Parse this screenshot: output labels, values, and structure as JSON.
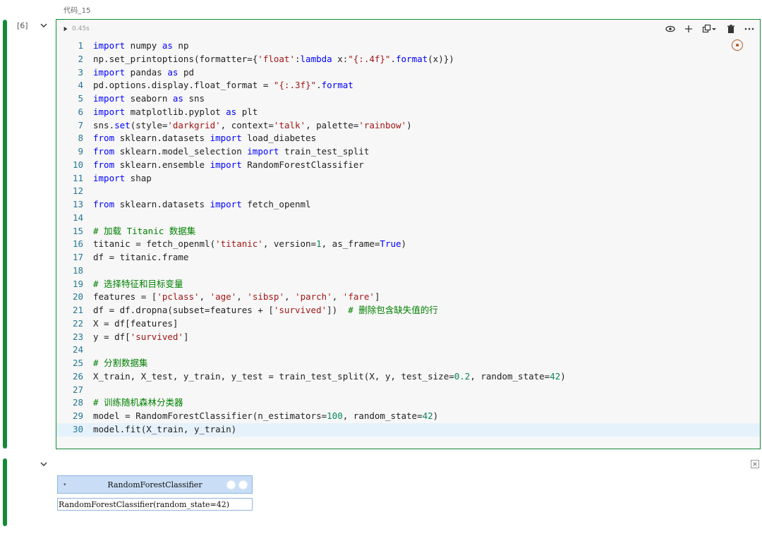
{
  "cell": {
    "title": "代码_15",
    "exec_count": "[6]",
    "exec_time": "0.45s"
  },
  "icons": {
    "run": "play-icon",
    "collapse": "chevron-down-icon",
    "toolbar": [
      "eye-icon",
      "plus-icon",
      "copy-icon",
      "chevron-down-icon",
      "trash-icon",
      "more-icon"
    ],
    "status": "execution-status-icon",
    "output_close": "close-icon"
  },
  "code": {
    "lines": [
      [
        {
          "t": "import",
          "k": "kw"
        },
        {
          "t": " numpy ",
          "k": "def"
        },
        {
          "t": "as",
          "k": "kw"
        },
        {
          "t": " np",
          "k": "def"
        }
      ],
      [
        {
          "t": "np.set_printoptions(formatter={",
          "k": "def"
        },
        {
          "t": "'float'",
          "k": "str"
        },
        {
          "t": ":",
          "k": "def"
        },
        {
          "t": "lambda",
          "k": "kw"
        },
        {
          "t": " x:",
          "k": "def"
        },
        {
          "t": "\"{:.4f}\"",
          "k": "str"
        },
        {
          "t": ".",
          "k": "def"
        },
        {
          "t": "format",
          "k": "kw"
        },
        {
          "t": "(x)})",
          "k": "def"
        }
      ],
      [
        {
          "t": "import",
          "k": "kw"
        },
        {
          "t": " pandas ",
          "k": "def"
        },
        {
          "t": "as",
          "k": "kw"
        },
        {
          "t": " pd",
          "k": "def"
        }
      ],
      [
        {
          "t": "pd.options.display.float_format = ",
          "k": "def"
        },
        {
          "t": "\"{:.3f}\"",
          "k": "str"
        },
        {
          "t": ".",
          "k": "def"
        },
        {
          "t": "format",
          "k": "kw"
        }
      ],
      [
        {
          "t": "import",
          "k": "kw"
        },
        {
          "t": " seaborn ",
          "k": "def"
        },
        {
          "t": "as",
          "k": "kw"
        },
        {
          "t": " sns",
          "k": "def"
        }
      ],
      [
        {
          "t": "import",
          "k": "kw"
        },
        {
          "t": " matplotlib.pyplot ",
          "k": "def"
        },
        {
          "t": "as",
          "k": "kw"
        },
        {
          "t": " plt",
          "k": "def"
        }
      ],
      [
        {
          "t": "sns.",
          "k": "def"
        },
        {
          "t": "set",
          "k": "kw"
        },
        {
          "t": "(style=",
          "k": "def"
        },
        {
          "t": "'darkgrid'",
          "k": "str"
        },
        {
          "t": ", context=",
          "k": "def"
        },
        {
          "t": "'talk'",
          "k": "str"
        },
        {
          "t": ", palette=",
          "k": "def"
        },
        {
          "t": "'rainbow'",
          "k": "str"
        },
        {
          "t": ")",
          "k": "def"
        }
      ],
      [
        {
          "t": "from",
          "k": "kw"
        },
        {
          "t": " sklearn.datasets ",
          "k": "def"
        },
        {
          "t": "import",
          "k": "kw"
        },
        {
          "t": " load_diabetes",
          "k": "def"
        }
      ],
      [
        {
          "t": "from",
          "k": "kw"
        },
        {
          "t": " sklearn.model_selection ",
          "k": "def"
        },
        {
          "t": "import",
          "k": "kw"
        },
        {
          "t": " train_test_split",
          "k": "def"
        }
      ],
      [
        {
          "t": "from",
          "k": "kw"
        },
        {
          "t": " sklearn.ensemble ",
          "k": "def"
        },
        {
          "t": "import",
          "k": "kw"
        },
        {
          "t": " RandomForestClassifier",
          "k": "def"
        }
      ],
      [
        {
          "t": "import",
          "k": "kw"
        },
        {
          "t": " shap",
          "k": "def"
        }
      ],
      [],
      [
        {
          "t": "from",
          "k": "kw"
        },
        {
          "t": " sklearn.datasets ",
          "k": "def"
        },
        {
          "t": "import",
          "k": "kw"
        },
        {
          "t": " fetch_openml",
          "k": "def"
        }
      ],
      [],
      [
        {
          "t": "# 加载 Titanic 数据集",
          "k": "com"
        }
      ],
      [
        {
          "t": "titanic = fetch_openml(",
          "k": "def"
        },
        {
          "t": "'titanic'",
          "k": "str"
        },
        {
          "t": ", version=",
          "k": "def"
        },
        {
          "t": "1",
          "k": "num"
        },
        {
          "t": ", as_frame=",
          "k": "def"
        },
        {
          "t": "True",
          "k": "kw"
        },
        {
          "t": ")",
          "k": "def"
        }
      ],
      [
        {
          "t": "df = titanic.frame",
          "k": "def"
        }
      ],
      [],
      [
        {
          "t": "# 选择特征和目标变量",
          "k": "com"
        }
      ],
      [
        {
          "t": "features = [",
          "k": "def"
        },
        {
          "t": "'pclass'",
          "k": "str"
        },
        {
          "t": ", ",
          "k": "def"
        },
        {
          "t": "'age'",
          "k": "str"
        },
        {
          "t": ", ",
          "k": "def"
        },
        {
          "t": "'sibsp'",
          "k": "str"
        },
        {
          "t": ", ",
          "k": "def"
        },
        {
          "t": "'parch'",
          "k": "str"
        },
        {
          "t": ", ",
          "k": "def"
        },
        {
          "t": "'fare'",
          "k": "str"
        },
        {
          "t": "]",
          "k": "def"
        }
      ],
      [
        {
          "t": "df = df.dropna(subset=features + [",
          "k": "def"
        },
        {
          "t": "'survived'",
          "k": "str"
        },
        {
          "t": "])  ",
          "k": "def"
        },
        {
          "t": "# 删除包含缺失值的行",
          "k": "com"
        }
      ],
      [
        {
          "t": "X = df[features]",
          "k": "def"
        }
      ],
      [
        {
          "t": "y = df[",
          "k": "def"
        },
        {
          "t": "'survived'",
          "k": "str"
        },
        {
          "t": "]",
          "k": "def"
        }
      ],
      [],
      [
        {
          "t": "# 分割数据集",
          "k": "com"
        }
      ],
      [
        {
          "t": "X_train, X_test, y_train, y_test = train_test_split(X, y, test_size=",
          "k": "def"
        },
        {
          "t": "0.2",
          "k": "num"
        },
        {
          "t": ", random_state=",
          "k": "def"
        },
        {
          "t": "42",
          "k": "num"
        },
        {
          "t": ")",
          "k": "def"
        }
      ],
      [],
      [
        {
          "t": "# 训练随机森林分类器",
          "k": "com"
        }
      ],
      [
        {
          "t": "model = RandomForestClassifier(n_estimators=",
          "k": "def"
        },
        {
          "t": "100",
          "k": "num"
        },
        {
          "t": ", random_state=",
          "k": "def"
        },
        {
          "t": "42",
          "k": "num"
        },
        {
          "t": ")",
          "k": "def"
        }
      ],
      [
        {
          "t": "model.fit(X_train, y_train)",
          "k": "def"
        }
      ]
    ],
    "active_line": 30
  },
  "output": {
    "estimator_name": "RandomForestClassifier",
    "estimator_repr": "RandomForestClassifier(random_state=42)"
  }
}
